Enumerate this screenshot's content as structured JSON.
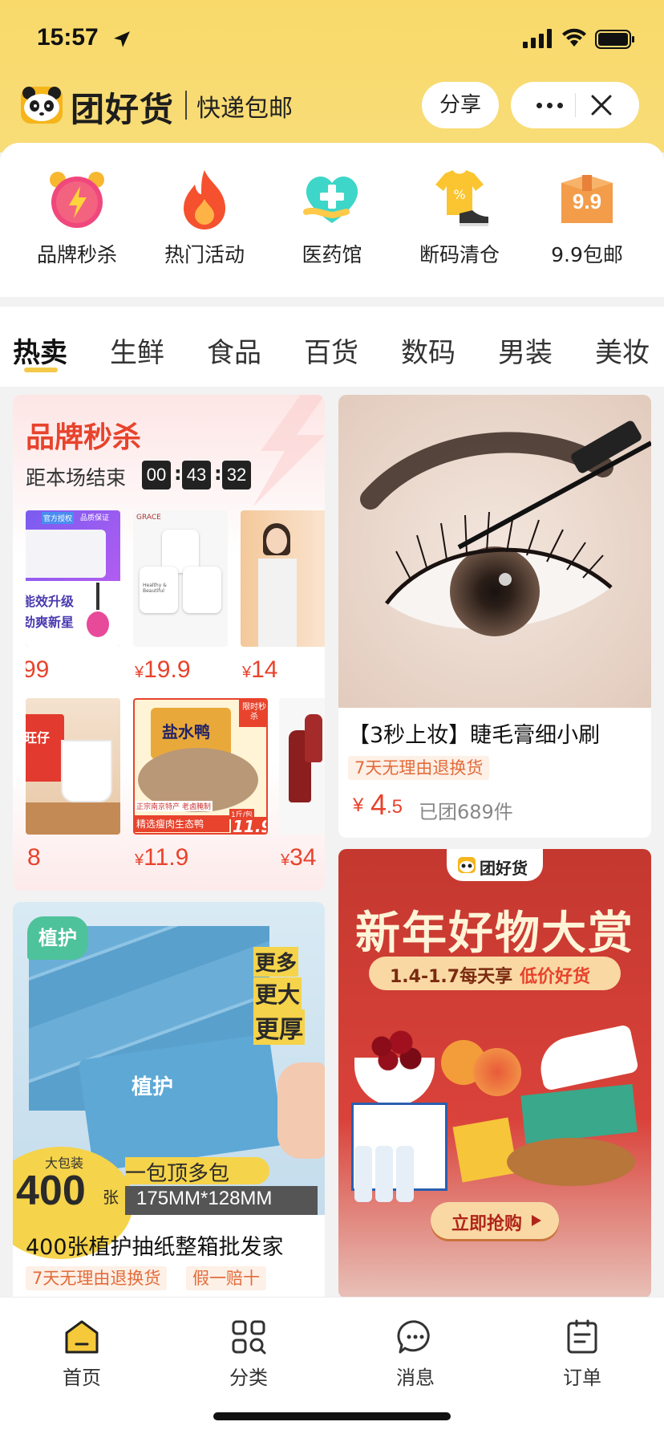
{
  "status": {
    "time": "15:57"
  },
  "header": {
    "brand_name": "团好货",
    "tagline": "快递包邮",
    "share_label": "分享"
  },
  "quick_entries": [
    {
      "label": "品牌秒杀",
      "icon": "alarm-clock-icon"
    },
    {
      "label": "热门活动",
      "icon": "flame-icon"
    },
    {
      "label": "医药馆",
      "icon": "medical-cross-icon"
    },
    {
      "label": "断码清仓",
      "icon": "tshirt-shoe-icon"
    },
    {
      "label": "9.9包邮",
      "icon": "package-box-icon",
      "badge": "9.9"
    }
  ],
  "tabs": [
    "热卖",
    "生鲜",
    "食品",
    "百货",
    "数码",
    "男装",
    "美妆"
  ],
  "flash_sale": {
    "title": "品牌秒杀",
    "subtitle": "距本场结束",
    "countdown": {
      "h": "00",
      "m": "43",
      "s": "32"
    },
    "row1": [
      {
        "price": "99",
        "thumb_text_1": "官方授权",
        "thumb_text_2": "品质保证",
        "thumb_text_3": "能效升级",
        "thumb_text_4": "劲爽新星"
      },
      {
        "price": "19.9",
        "currency": "¥",
        "thumb_text_1": "GRACE",
        "thumb_text_2": "Healthy & Beautiful"
      },
      {
        "price": "14",
        "currency": "¥"
      }
    ],
    "row2": [
      {
        "price": "8",
        "thumb_text_1": "旺仔"
      },
      {
        "price": "11.9",
        "currency": "¥",
        "thumb_text_1": "限时秒杀",
        "thumb_text_2": "盐水鸭",
        "thumb_text_3": "正宗南京特产 老卤腌制",
        "thumb_text_4": "精选瘦肉生态鸭",
        "thumb_text_5": "11.9",
        "thumb_text_6": "1斤/包"
      },
      {
        "price": "34",
        "currency": "¥"
      }
    ]
  },
  "product_mascara": {
    "title": "【3秒上妆】睫毛膏细小刷",
    "tag": "7天无理由退换货",
    "currency": "¥",
    "price_int": "4",
    "price_dec": ".5",
    "sold": "已团689件"
  },
  "product_tissue": {
    "title": "400张植护抽纸整箱批发家",
    "tags": [
      "7天无理由退换货",
      "假一赔十"
    ],
    "brand": "植护",
    "slogan": [
      "更多",
      "更大",
      "更厚"
    ],
    "big_label": "大包装",
    "count": "400",
    "count_unit": "张",
    "banner_line1": "一包顶多包",
    "banner_line2": "175MM*128MM"
  },
  "new_year_banner": {
    "logo": "团好货",
    "title": "新年好物大赏",
    "date_text": "1.4-1.7每天享",
    "date_highlight": "低价好货",
    "cta": "立即抢购"
  },
  "tabbar": [
    {
      "label": "首页",
      "icon": "home-icon"
    },
    {
      "label": "分类",
      "icon": "grid-search-icon"
    },
    {
      "label": "消息",
      "icon": "chat-bubble-icon"
    },
    {
      "label": "订单",
      "icon": "clipboard-icon"
    }
  ],
  "colors": {
    "brand_yellow": "#f8d96a",
    "price_red": "#e8432c",
    "tag_orange": "#e36b3c"
  }
}
